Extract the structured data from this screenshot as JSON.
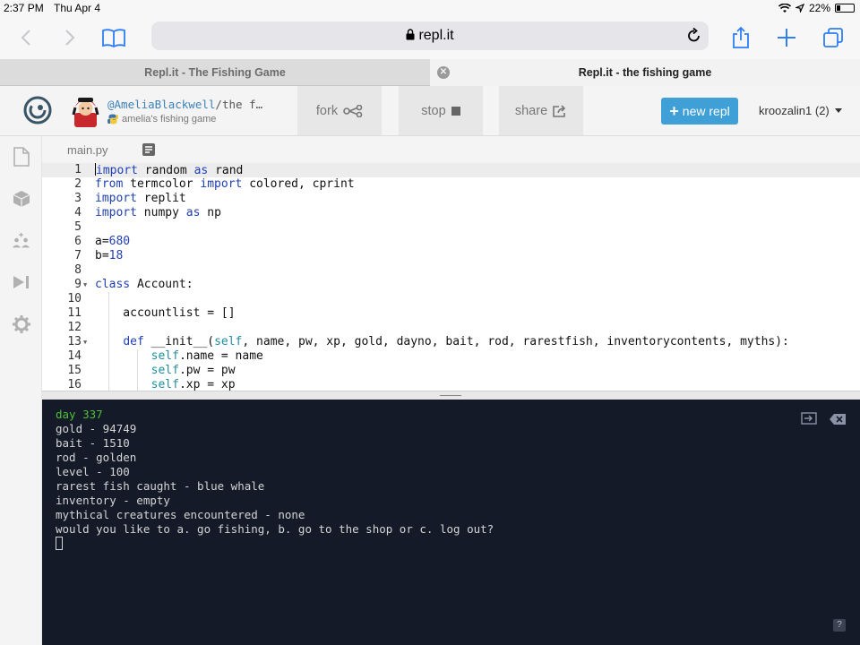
{
  "status_bar": {
    "time": "2:37 PM",
    "date": "Thu Apr 4",
    "battery_text": "22%",
    "battery_level": 0.22
  },
  "browser": {
    "url": "repl.it",
    "tabs": [
      {
        "label": "Repl.it - The Fishing Game",
        "active": false
      },
      {
        "label": "Repl.it - the fishing game",
        "active": true
      }
    ]
  },
  "repl_header": {
    "user": "@AmeliaBlackwell",
    "slug_rest": "/the f…",
    "subtitle": "amelia's fishing game",
    "fork_label": "fork",
    "stop_label": "stop",
    "share_label": "share",
    "new_repl_label": "new repl",
    "account_label": "kroozalin1 (2)"
  },
  "editor": {
    "file_tab": "main.py",
    "lines": [
      {
        "n": "1",
        "text": "import random as rand"
      },
      {
        "n": "2",
        "text": "from termcolor import colored, cprint"
      },
      {
        "n": "3",
        "text": "import replit"
      },
      {
        "n": "4",
        "text": "import numpy as np"
      },
      {
        "n": "5",
        "text": ""
      },
      {
        "n": "6",
        "text": "a=680"
      },
      {
        "n": "7",
        "text": "b=18"
      },
      {
        "n": "8",
        "text": ""
      },
      {
        "n": "9",
        "text": "class Account:"
      },
      {
        "n": "10",
        "text": ""
      },
      {
        "n": "11",
        "text": "    accountlist = []"
      },
      {
        "n": "12",
        "text": ""
      },
      {
        "n": "13",
        "text": "    def __init__(self, name, pw, xp, gold, dayno, bait, rod, rarestfish, inventorycontents, myths):"
      },
      {
        "n": "14",
        "text": "        self.name = name"
      },
      {
        "n": "15",
        "text": "        self.pw = pw"
      },
      {
        "n": "16",
        "text": "        self.xp = xp"
      }
    ]
  },
  "console": {
    "lines": [
      "day 337",
      "gold - 94749",
      "bait - 1510",
      "rod - golden",
      "level - 100",
      "rarest fish caught - blue whale",
      "inventory - empty",
      "mythical creatures encountered - none",
      "would you like to a. go fishing, b. go to the shop or c. log out?"
    ],
    "help_label": "?"
  },
  "colors": {
    "console_bg": "#141a28",
    "accent": "#3fa0d8",
    "keyword": "#1f3fb5",
    "self": "#218d9e",
    "console_green": "#4fbf3a"
  }
}
